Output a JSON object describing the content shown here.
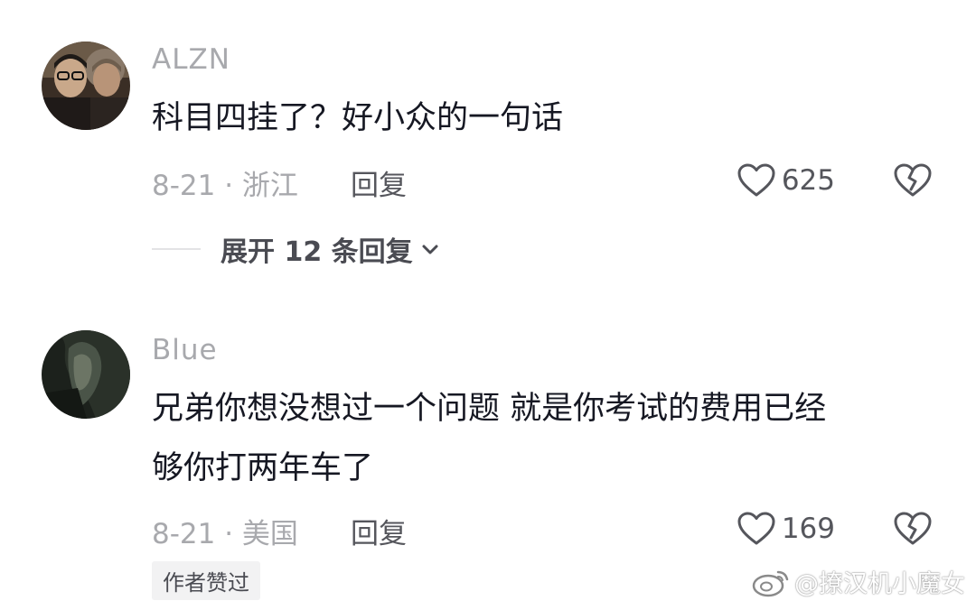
{
  "comments": [
    {
      "username": "ALZN",
      "lines": [
        "科目四挂了？好小众的一句话"
      ],
      "date_location": "8-21 · 浙江",
      "reply_label": "回复",
      "likes": "625",
      "expand_label": "展开 12 条回复"
    },
    {
      "username": "Blue",
      "lines": [
        "兄弟你想没想过一个问题 就是你考试的费用已经",
        "够你打两年车了"
      ],
      "date_location": "8-21 · 美国",
      "reply_label": "回复",
      "likes": "169",
      "badge": "作者赞过"
    }
  ],
  "icons": {
    "like": "heart-outline-icon",
    "dislike": "broken-heart-icon",
    "expand": "chevron-down-icon",
    "watermark": "weibo-logo-icon"
  },
  "watermark": {
    "text": "@撩汉机小魔女"
  },
  "colors": {
    "primary_text": "#161823",
    "secondary_text": "#a8a9ad",
    "action_text": "#55565c"
  }
}
